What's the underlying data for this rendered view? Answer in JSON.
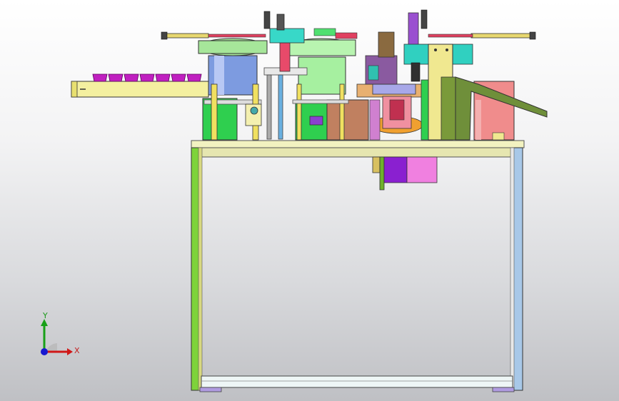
{
  "viewport": {
    "background_top": "#ffffff",
    "background_bottom": "#bfc0c4"
  },
  "triad": {
    "x_label": "X",
    "y_label": "Y",
    "x_color": "#d01818",
    "y_color": "#18a018",
    "z_color": "#1818d0"
  },
  "model": {
    "frame_color": "#f2f2c0",
    "leg_left_color": "#7ed33a",
    "leg_right_color": "#a8c8e8",
    "bowl_left_color": "#a6e69a",
    "bowl_left_drum_color": "#7d9be0",
    "bowl_right_color": "#a6f0a0",
    "conveyor_color": "#f4f0a0",
    "conveyor_cups_color": "#c020c0",
    "chute_color": "#6f8f3a",
    "hopper_color": "#e88a8a",
    "motor_color": "#f080e0"
  }
}
